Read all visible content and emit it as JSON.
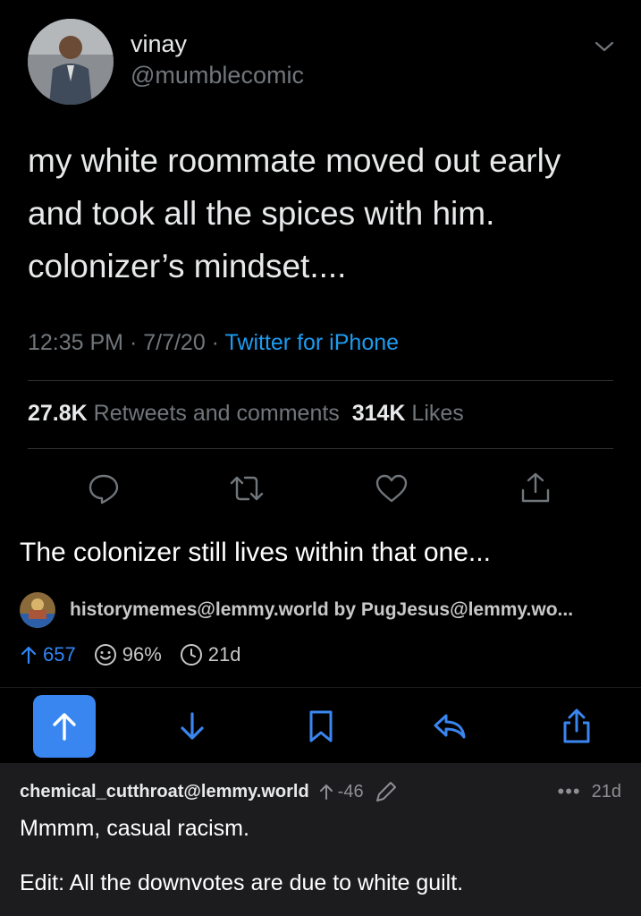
{
  "tweet": {
    "name": "vinay",
    "handle": "@mumblecomic",
    "text": "my white roommate moved out early and took all the spices with him. colonizer’s mindset....",
    "time_date": "12:35 PM · 7/7/20 · ",
    "source": "Twitter for iPhone",
    "retweets_count": "27.8K",
    "retweets_label": "Retweets and comments",
    "likes_count": "314K",
    "likes_label": "Likes"
  },
  "post": {
    "title": "The colonizer still lives within that one...",
    "community": "historymemes@lemmy.world",
    "by_label": "by",
    "author": "PugJesus@lemmy.wo...",
    "score": "657",
    "upvote_ratio": "96%",
    "age": "21d"
  },
  "toolbar": {
    "icons": [
      "upvote-icon",
      "downvote-icon",
      "bookmark-icon",
      "reply-icon",
      "share-icon"
    ]
  },
  "comment": {
    "author": "chemical_cutthroat@lemmy.world",
    "score": "-46",
    "age": "21d",
    "line1": "Mmmm, casual racism.",
    "line2": "Edit: All the downvotes are due to white guilt."
  },
  "colors": {
    "background": "#000000",
    "accent": "#3a86f0",
    "twitter_blue": "#1d9bf0",
    "comment_bg": "#1c1c1e"
  }
}
